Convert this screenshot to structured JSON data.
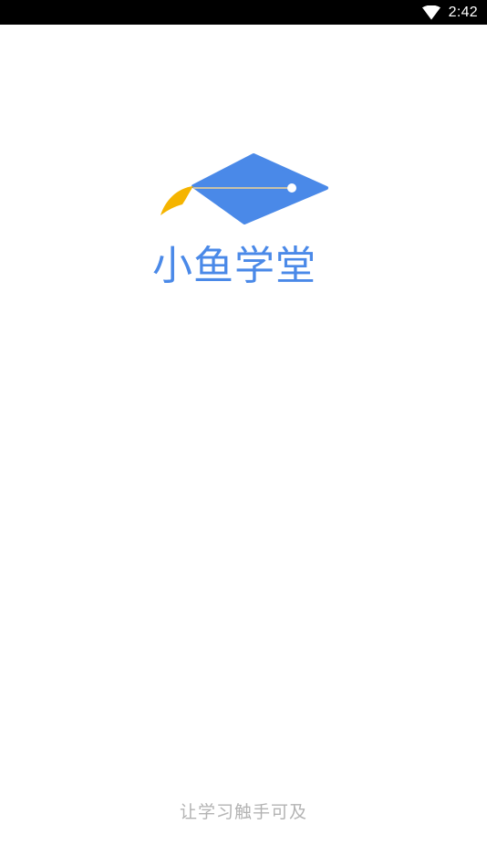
{
  "status_bar": {
    "time": "2:42",
    "wifi_icon": "wifi-icon"
  },
  "splash": {
    "logo_icon": "graduation-cap-icon",
    "brand_name": "小鱼学堂",
    "slogan": "让学习触手可及"
  },
  "colors": {
    "brand_blue": "#4a89e8",
    "tassel_yellow": "#f5b400",
    "slogan_gray": "#b3b3b3",
    "background": "#ffffff",
    "status_bar": "#000000"
  }
}
